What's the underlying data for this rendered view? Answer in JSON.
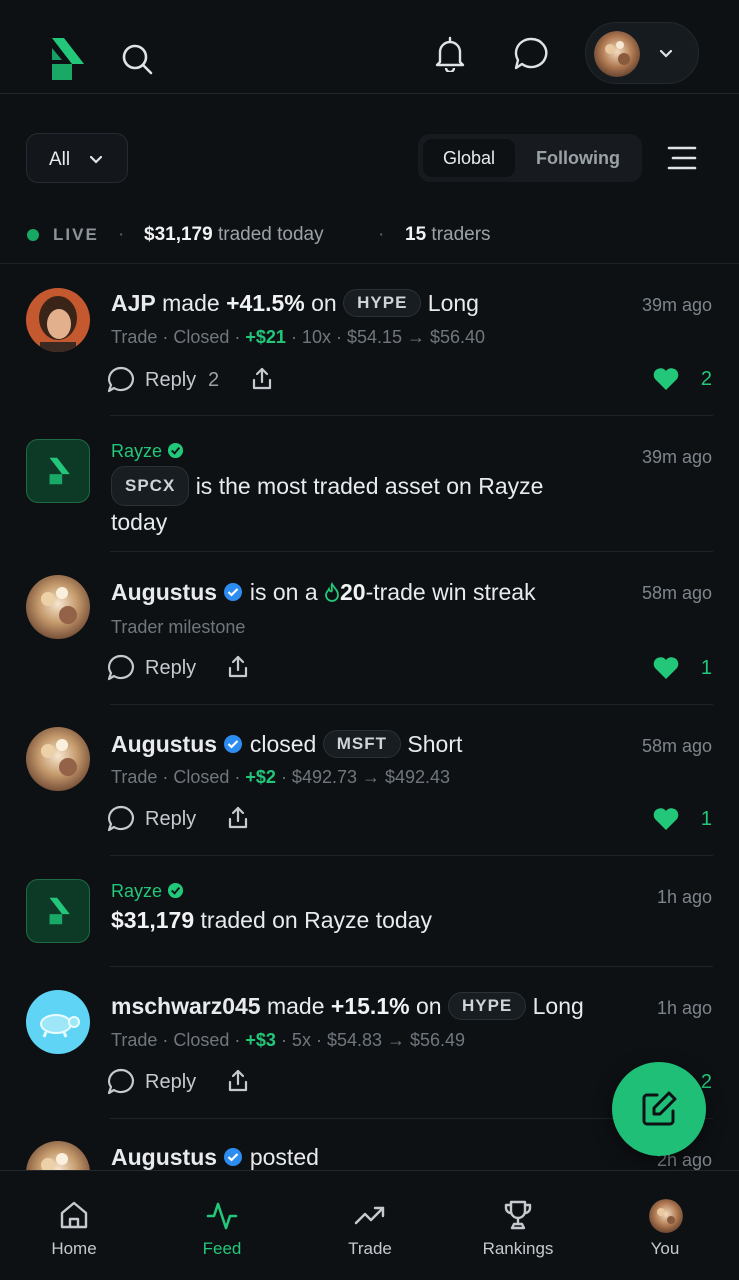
{
  "header": {
    "icons": [
      "rayze-logo",
      "search-icon",
      "bell-icon",
      "chat-icon",
      "avatar",
      "chevron-down-icon"
    ]
  },
  "filters": {
    "dropdown_label": "All",
    "segment": [
      "Global",
      "Following"
    ],
    "selected_segment": "Global"
  },
  "live": {
    "label": "LIVE",
    "amount": "$31,179",
    "amount_suffix": "traded today",
    "traders_count": "15",
    "traders_suffix": "traders",
    "separator": "·"
  },
  "feed": {
    "item0": {
      "user": "AJP",
      "verb": "made",
      "pct": "+41.5%",
      "on": "on",
      "ticker": "HYPE",
      "side": "Long",
      "time": "39m ago",
      "sub_a": "Trade · Closed · ",
      "pnl": "+$21",
      "sub_b": " · 10x · $54.15 → $56.40",
      "reply_label": "Reply",
      "reply_count": "2",
      "likes": "2"
    },
    "item1": {
      "brand": "Rayze",
      "ticker": "SPCX",
      "text_a": "is the most traded asset on Rayze",
      "text_b": "today",
      "time": "39m ago"
    },
    "item2": {
      "user": "Augustus",
      "text_a": "is on a",
      "streak": "20",
      "text_b": "-trade win streak",
      "time": "58m ago",
      "sub": "Trader milestone",
      "reply_label": "Reply",
      "likes": "1"
    },
    "item3": {
      "user": "Augustus",
      "verb": "closed",
      "ticker": "MSFT",
      "side": "Short",
      "time": "58m ago",
      "sub_a": "Trade · Closed · ",
      "pnl": "+$2",
      "sub_b": " · $492.73 → $492.43",
      "reply_label": "Reply",
      "likes": "1"
    },
    "item4": {
      "brand": "Rayze",
      "amount": "$31,179",
      "text": "traded on Rayze today",
      "time": "1h ago"
    },
    "item5": {
      "user": "mschwarz045",
      "verb": "made",
      "pct": "+15.1%",
      "on": "on",
      "ticker": "HYPE",
      "side": "Long",
      "time": "1h ago",
      "sub_a": "Trade · Closed · ",
      "pnl": "+$3",
      "sub_b": " · 5x · $54.83 → $56.49",
      "reply_label": "Reply",
      "likes": "2"
    },
    "item6": {
      "user": "Augustus",
      "verb": "posted",
      "time": "2h ago"
    }
  },
  "nav": {
    "tabs": [
      "Home",
      "Feed",
      "Trade",
      "Rankings",
      "You"
    ],
    "active": "Feed"
  },
  "colors": {
    "accent": "#22c77a",
    "background": "#0e1114",
    "verified": "#2d8cf0"
  }
}
